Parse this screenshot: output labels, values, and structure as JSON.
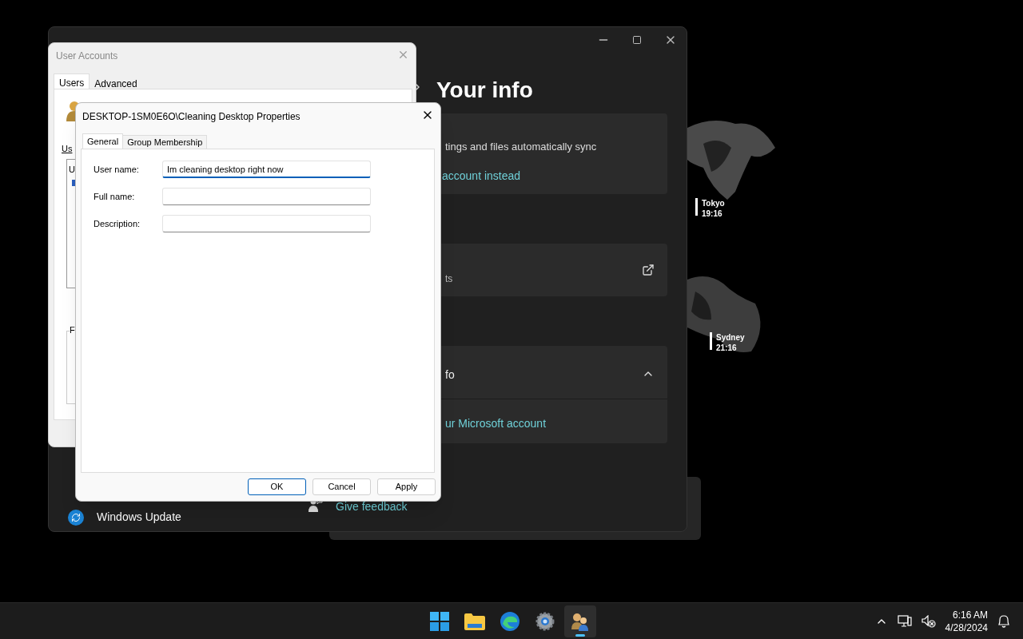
{
  "settings_window": {
    "heading": "Your info",
    "cards": [
      {
        "kind": "text_link",
        "text": "tings and files automatically sync",
        "link": "account instead"
      },
      {
        "kind": "external",
        "text": "ts"
      },
      {
        "kind": "expander",
        "text": "fo",
        "expanded": true,
        "link": "ur Microsoft account"
      }
    ],
    "feedback_link": "Give feedback",
    "sidebar_item": "Windows Update"
  },
  "world_clock": [
    {
      "city": "Tokyo",
      "time": "19:16"
    },
    {
      "city": "Sydney",
      "time": "21:16"
    }
  ],
  "user_accounts": {
    "title": "User Accounts",
    "tabs": [
      {
        "label": "Users",
        "selected": true
      },
      {
        "label": "Advanced",
        "selected": false
      }
    ],
    "fragments": [
      "Us",
      "U",
      "F"
    ]
  },
  "properties": {
    "title": "DESKTOP-1SM0E6O\\Cleaning Desktop Properties",
    "tabs": [
      {
        "label": "General",
        "selected": true
      },
      {
        "label": "Group Membership",
        "selected": false
      }
    ],
    "fields": [
      {
        "label": "User name:",
        "value": "Im cleaning desktop right now",
        "focused": true
      },
      {
        "label": "Full name:",
        "focused": false
      },
      {
        "label": "Description:",
        "focused": false
      }
    ],
    "buttons": [
      {
        "label": "OK",
        "default": true
      },
      {
        "label": "Cancel",
        "default": false
      },
      {
        "label": "Apply",
        "default": false
      }
    ]
  },
  "taskbar": {
    "apps": [
      {
        "kind": "start",
        "active": false
      },
      {
        "kind": "explorer",
        "active": false
      },
      {
        "kind": "edge",
        "active": false
      },
      {
        "kind": "settings",
        "active": false
      },
      {
        "kind": "users",
        "active": true
      }
    ],
    "time": "6:16 AM",
    "date": "4/28/2024"
  }
}
